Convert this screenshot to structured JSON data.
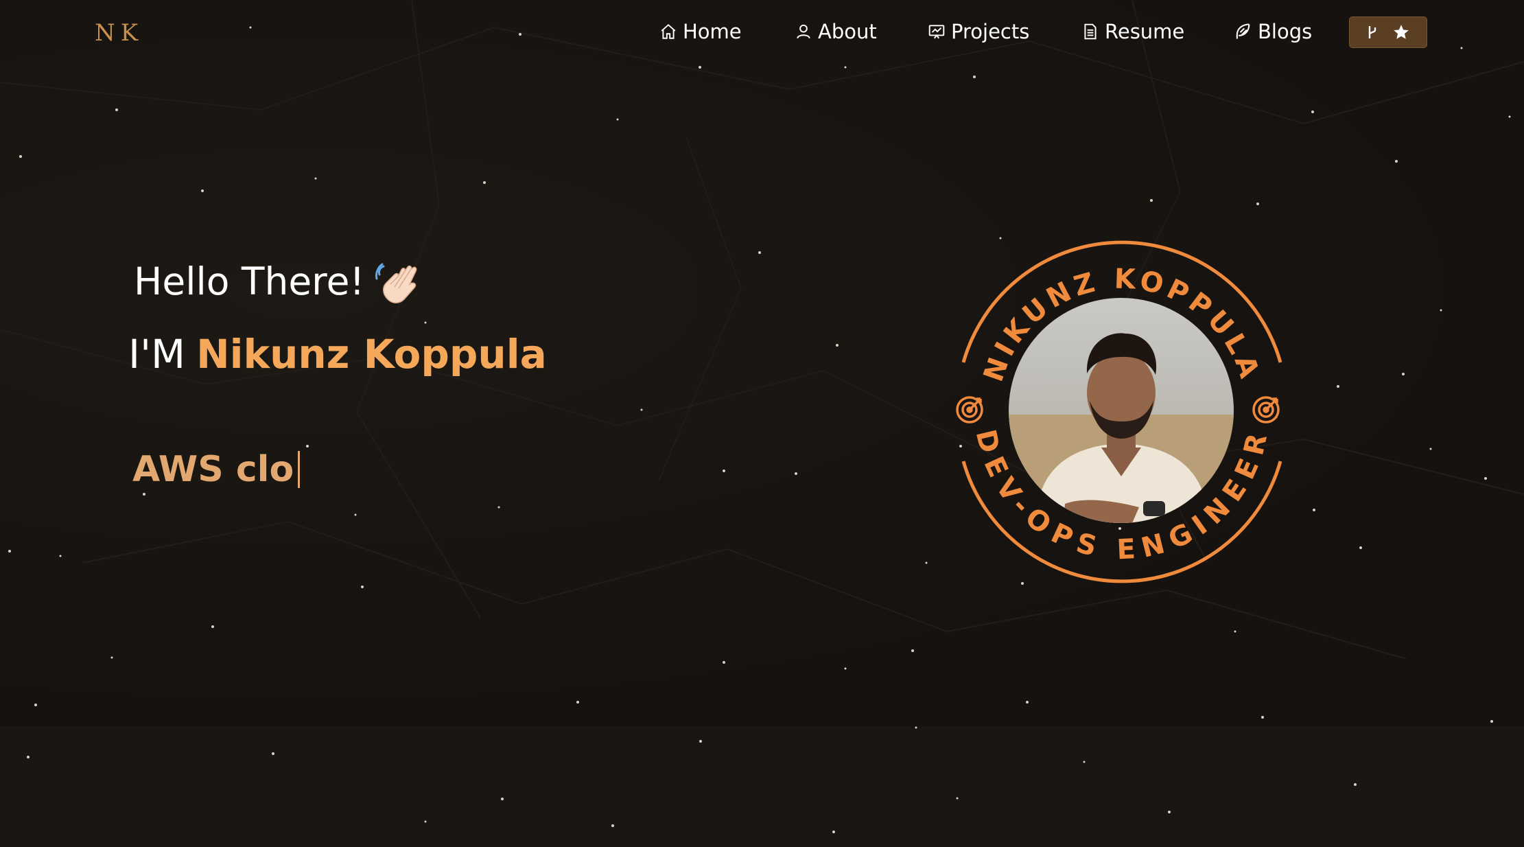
{
  "navbar": {
    "logo": "NK",
    "items": [
      {
        "label": "Home",
        "icon": "home-icon"
      },
      {
        "label": "About",
        "icon": "user-icon"
      },
      {
        "label": "Projects",
        "icon": "presentation-icon"
      },
      {
        "label": "Resume",
        "icon": "document-icon"
      },
      {
        "label": "Blogs",
        "icon": "feather-icon"
      }
    ],
    "fork_button": {
      "icons": [
        "git-fork-icon",
        "star-icon"
      ]
    }
  },
  "hero": {
    "greeting": "Hello There!",
    "greeting_emoji": "waving-hand-icon",
    "intro_prefix": "I'M",
    "name": "Nikunz Koppula",
    "typed_text": "AWS clo"
  },
  "badge": {
    "top_text": "NIKUNZ KOPPULA",
    "bottom_text": "DEV-OPS ENGINEER",
    "icons": [
      "target-icon",
      "target-icon"
    ]
  },
  "colors": {
    "background": "#16120f",
    "accent": "#f5a85a",
    "accent_dark": "#5a3f22",
    "badge_orange": "#f08a3c",
    "logo": "#c8904a"
  }
}
